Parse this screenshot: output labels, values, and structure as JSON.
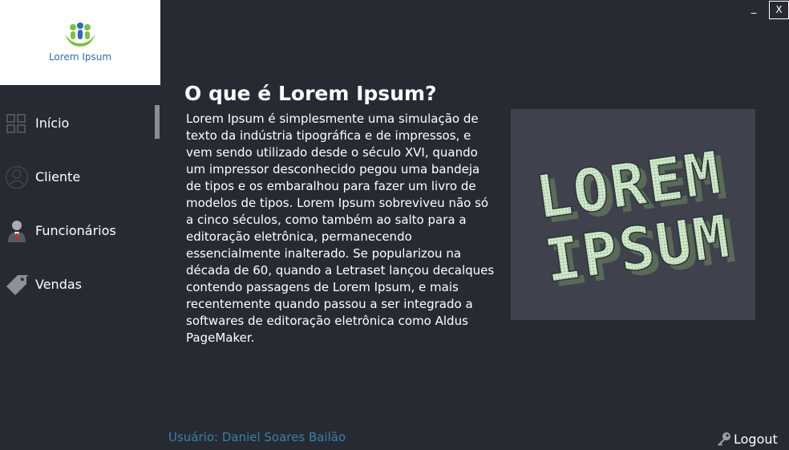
{
  "brand": {
    "name": "Lorem Ipsum"
  },
  "window": {
    "minimize": "_",
    "close": "X"
  },
  "nav": {
    "items": [
      {
        "label": "Início",
        "icon": "grid-icon"
      },
      {
        "label": "Cliente",
        "icon": "user-icon"
      },
      {
        "label": "Funcionários",
        "icon": "employee-icon"
      },
      {
        "label": "Vendas",
        "icon": "tag-icon"
      }
    ],
    "active": "Início"
  },
  "content": {
    "title": "O que é Lorem Ipsum?",
    "body": "Lorem Ipsum é simplesmente uma simulação de texto da indústria tipográfica e de impressos, e vem sendo utilizado desde o século XVI, quando um impressor desconhecido pegou uma bandeja de tipos e os embaralhou para fazer um livro de modelos de tipos. Lorem Ipsum sobreviveu não só a cinco séculos, como também ao salto para a editoração eletrônica, permanecendo essencialmente inalterado. Se popularizou na década de 60, quando a Letraset lançou decalques contendo passagens de Lorem Ipsum, e mais recentemente quando passou a ser integrado a softwares de editoração eletrônica como Aldus PageMaker.",
    "image_text": "LOREM IPSUM"
  },
  "footer": {
    "user": "Usuário: Daniel Soares Bailão",
    "logout": "Logout"
  },
  "colors": {
    "background": "#262b33",
    "logo_panel": "#ffffff",
    "user_label": "#3a7fa6",
    "image_panel": "#3f424c",
    "image_letters": "#cfe8c8"
  }
}
